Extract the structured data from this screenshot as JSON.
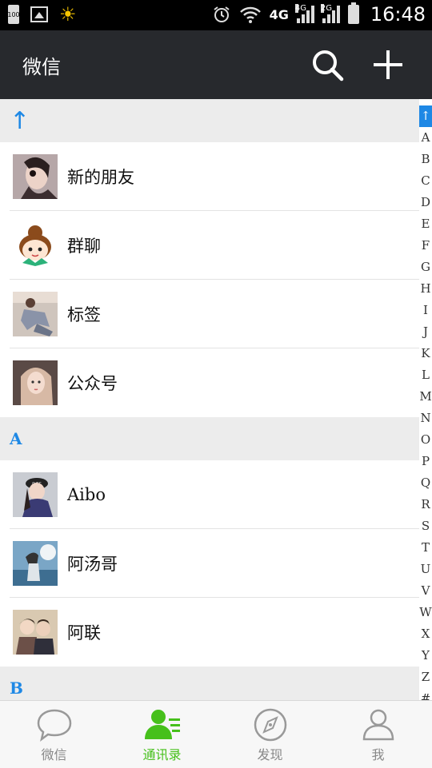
{
  "status_bar": {
    "battery_small": "100",
    "network": "4G",
    "network_small_1": "4G",
    "network_small_2": "2G",
    "time": "16:48"
  },
  "header": {
    "title": "微信",
    "search_icon": "search-icon",
    "add_icon": "plus-icon"
  },
  "contacts": {
    "top_section": "↑",
    "system_items": [
      {
        "name": "新的朋友"
      },
      {
        "name": "群聊"
      },
      {
        "name": "标签"
      },
      {
        "name": "公众号"
      }
    ],
    "section_a": "A",
    "a_items": [
      {
        "name": "Aibo"
      },
      {
        "name": "阿汤哥"
      },
      {
        "name": "阿联"
      }
    ],
    "section_b": "B"
  },
  "index_bar": [
    "↑",
    "A",
    "B",
    "C",
    "D",
    "E",
    "F",
    "G",
    "H",
    "I",
    "J",
    "K",
    "L",
    "M",
    "N",
    "O",
    "P",
    "Q",
    "R",
    "S",
    "T",
    "U",
    "V",
    "W",
    "X",
    "Y",
    "Z",
    "#"
  ],
  "bottom_nav": {
    "tabs": [
      {
        "label": "微信",
        "icon": "chat-bubble-icon"
      },
      {
        "label": "通讯录",
        "icon": "contacts-icon"
      },
      {
        "label": "发现",
        "icon": "compass-icon"
      },
      {
        "label": "我",
        "icon": "person-icon"
      }
    ],
    "active_color": "#46c01b"
  }
}
